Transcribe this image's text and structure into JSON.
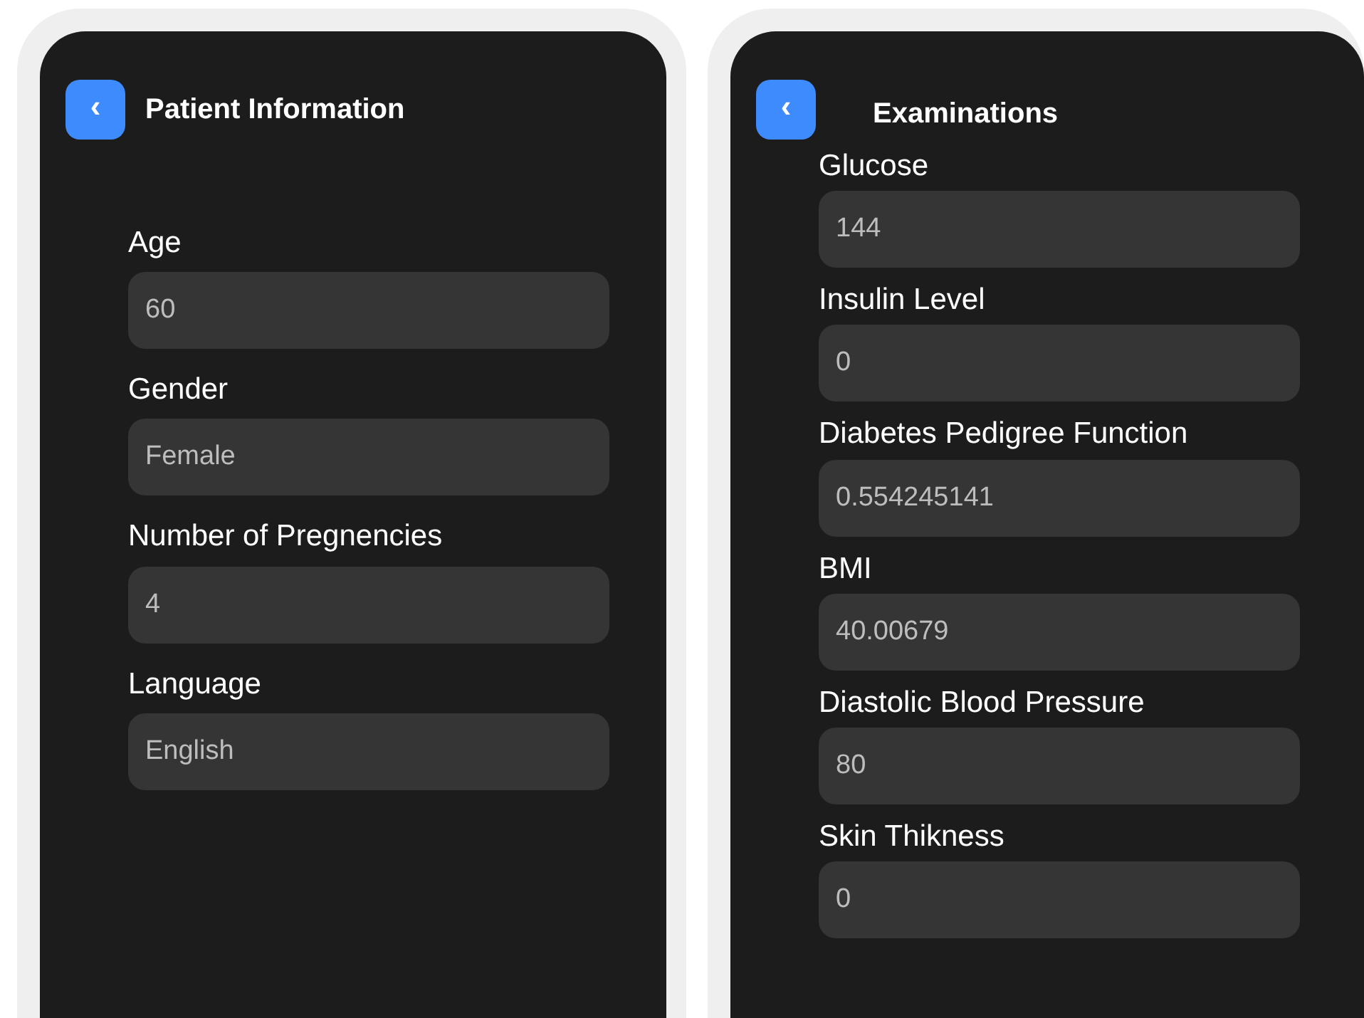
{
  "screens": [
    {
      "title": "Patient Information",
      "back_button": "‹",
      "fields": [
        {
          "label": "Age",
          "value": "60"
        },
        {
          "label": "Gender",
          "value": "Female"
        },
        {
          "label": "Number of Pregnencies",
          "value": "4"
        },
        {
          "label": "Language",
          "value": "English"
        }
      ]
    },
    {
      "title": "Examinations",
      "back_button": "‹",
      "fields": [
        {
          "label": "Glucose",
          "value": "144"
        },
        {
          "label": "Insulin Level",
          "value": "0"
        },
        {
          "label": "Diabetes Pedigree Function",
          "value": "0.554245141"
        },
        {
          "label": "BMI",
          "value": "40.00679"
        },
        {
          "label": "Diastolic Blood Pressure",
          "value": "80"
        },
        {
          "label": "Skin Thikness",
          "value": "0"
        }
      ]
    }
  ]
}
